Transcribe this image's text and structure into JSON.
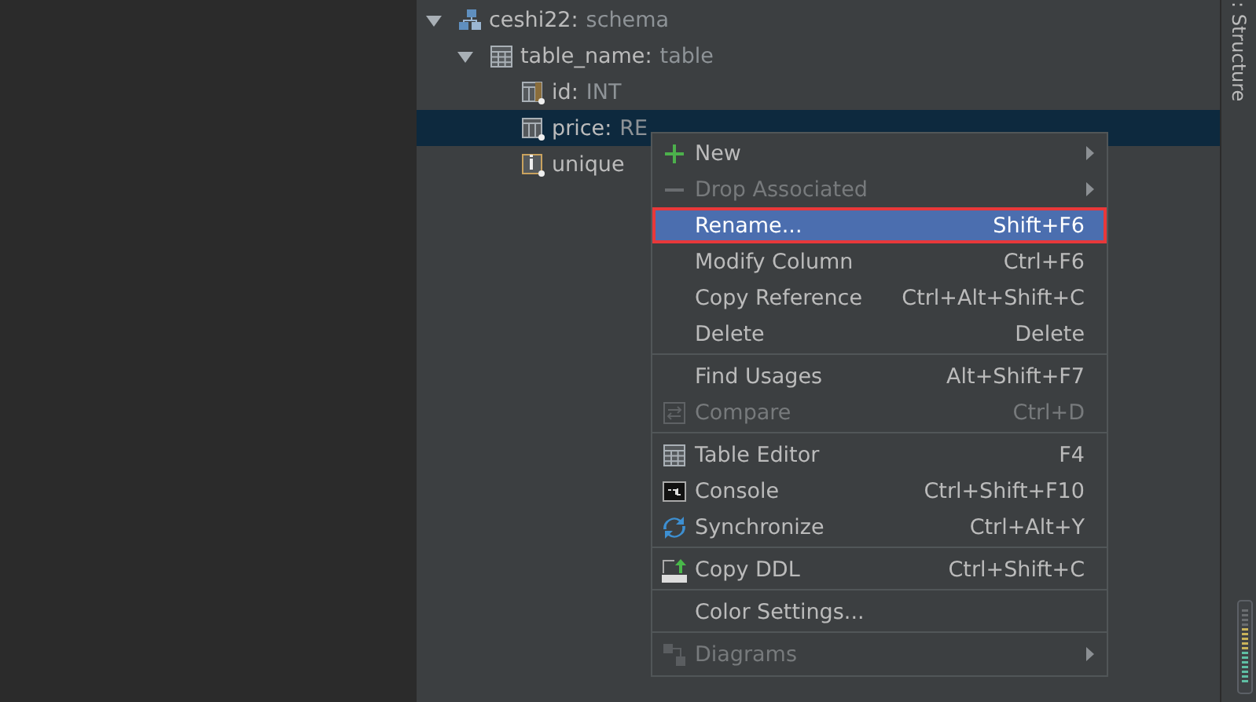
{
  "tree": [
    {
      "label": "ceshi22:",
      "type": "schema",
      "kind": "schema",
      "expanded": true,
      "selected": false,
      "children": [
        {
          "label": "table_name:",
          "type": "table",
          "kind": "table",
          "expanded": true,
          "selected": false,
          "children": [
            {
              "label": "id:",
              "type": "INT",
              "kind": "key-column",
              "selected": false
            },
            {
              "label": "price:",
              "type": "RE",
              "kind": "column",
              "selected": true
            },
            {
              "label": "unique",
              "kind": "index",
              "selected": false
            }
          ]
        }
      ]
    }
  ],
  "side_tab": {
    "label": ": Structure"
  },
  "context_menu": {
    "items": [
      {
        "kind": "plus",
        "label": "New",
        "submenu": true,
        "disabled": false,
        "selected": false
      },
      {
        "kind": "minus",
        "label": "Drop Associated",
        "submenu": true,
        "disabled": true,
        "selected": false
      },
      {
        "kind": "text",
        "label": "Rename...",
        "shortcut": "Shift+F6",
        "submenu": false,
        "disabled": false,
        "selected": true
      },
      {
        "kind": "text",
        "label": "Modify Column",
        "shortcut": "Ctrl+F6",
        "submenu": false,
        "disabled": false,
        "selected": false
      },
      {
        "kind": "text",
        "label": "Copy Reference",
        "shortcut": "Ctrl+Alt+Shift+C",
        "submenu": false,
        "disabled": false,
        "selected": false
      },
      {
        "kind": "text",
        "label": "Delete",
        "shortcut": "Delete",
        "submenu": false,
        "disabled": false,
        "selected": false
      },
      {
        "kind": "separator"
      },
      {
        "kind": "text",
        "label": "Find Usages",
        "shortcut": "Alt+Shift+F7",
        "submenu": false,
        "disabled": false,
        "selected": false
      },
      {
        "kind": "compare",
        "label": "Compare",
        "shortcut": "Ctrl+D",
        "submenu": false,
        "disabled": true,
        "selected": false
      },
      {
        "kind": "separator"
      },
      {
        "kind": "table",
        "label": "Table Editor",
        "shortcut": "F4",
        "submenu": false,
        "disabled": false,
        "selected": false
      },
      {
        "kind": "console",
        "label": "Console",
        "shortcut": "Ctrl+Shift+F10",
        "submenu": false,
        "disabled": false,
        "selected": false
      },
      {
        "kind": "sync",
        "label": "Synchronize",
        "shortcut": "Ctrl+Alt+Y",
        "submenu": false,
        "disabled": false,
        "selected": false
      },
      {
        "kind": "separator"
      },
      {
        "kind": "ddl",
        "label": "Copy DDL",
        "shortcut": "Ctrl+Shift+C",
        "submenu": false,
        "disabled": false,
        "selected": false
      },
      {
        "kind": "separator"
      },
      {
        "kind": "text",
        "label": "Color Settings...",
        "submenu": false,
        "disabled": false,
        "selected": false
      },
      {
        "kind": "separator"
      },
      {
        "kind": "diagram",
        "label": "Diagrams",
        "submenu": true,
        "disabled": true,
        "selected": false
      }
    ]
  }
}
